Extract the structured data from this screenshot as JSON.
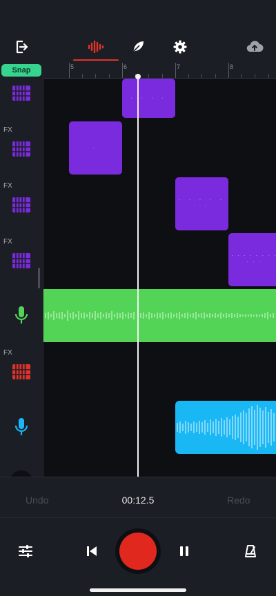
{
  "toolbar": {
    "icons": [
      "exit-icon",
      "waveform-icon",
      "feather-icon",
      "gear-icon",
      "cloud-upload-icon"
    ],
    "active_tab": "waveform",
    "accent_color": "#e0322a"
  },
  "snap": {
    "label": "Snap",
    "color": "#36d48f"
  },
  "ruler": {
    "marks": [
      "5",
      "6",
      "7",
      "8"
    ]
  },
  "tracks": [
    {
      "fx_label": "",
      "instrument": "keyboard-icon",
      "color": "#7a2bdd"
    },
    {
      "fx_label": "FX",
      "instrument": "keyboard-icon",
      "color": "#7a2bdd"
    },
    {
      "fx_label": "FX",
      "instrument": "keyboard-icon",
      "color": "#7a2bdd"
    },
    {
      "fx_label": "FX",
      "instrument": "keyboard-icon",
      "color": "#7a2bdd"
    },
    {
      "fx_label": "",
      "instrument": "microphone-icon",
      "color": "#54d457"
    },
    {
      "fx_label": "FX",
      "instrument": "keyboard-icon",
      "color": "#e0322a"
    },
    {
      "fx_label": "",
      "instrument": "microphone-icon",
      "color": "#1ab7f5"
    }
  ],
  "transport": {
    "undo_label": "Undo",
    "redo_label": "Redo",
    "time": "00:12.5",
    "record_color": "#e0281e"
  }
}
